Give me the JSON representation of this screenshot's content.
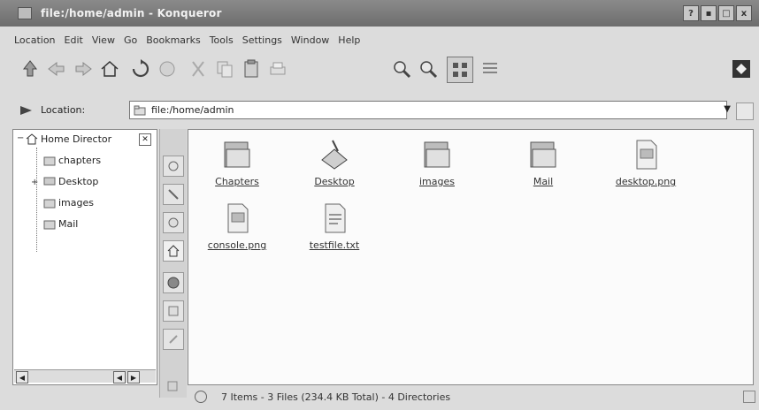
{
  "window": {
    "title": "file:/home/admin - Konqueror",
    "controls": [
      "?",
      "▪",
      "□",
      "x"
    ]
  },
  "menubar": {
    "items": [
      "Location",
      "Edit",
      "View",
      "Go",
      "Bookmarks",
      "Tools",
      "Settings",
      "Window",
      "Help"
    ]
  },
  "toolbar": {
    "icons": [
      "up-arrow-icon",
      "back-arrow-icon",
      "forward-arrow-icon",
      "home-icon",
      "reload-icon",
      "stop-icon",
      "cut-icon",
      "copy-icon",
      "paste-icon",
      "print-icon",
      "zoom-in-icon",
      "zoom-out-icon",
      "icon-view-icon",
      "detail-view-icon",
      "konqueror-logo-icon"
    ]
  },
  "location": {
    "label": "Location:",
    "value": "file:/home/admin"
  },
  "tree": {
    "root": "Home Director",
    "children": [
      "chapters",
      "Desktop",
      "images",
      "Mail"
    ]
  },
  "main": {
    "items": [
      {
        "label": "Chapters",
        "icon": "folder-icon"
      },
      {
        "label": "Desktop",
        "icon": "desktop-icon"
      },
      {
        "label": "images",
        "icon": "folder-icon"
      },
      {
        "label": "Mail",
        "icon": "folder-icon"
      },
      {
        "label": "desktop.png",
        "icon": "png-file-icon"
      },
      {
        "label": "console.png",
        "icon": "png-file-icon"
      },
      {
        "label": "testfile.txt",
        "icon": "text-file-icon"
      }
    ]
  },
  "status": {
    "text": "7 Items - 3 Files (234.4 KB Total) - 4 Directories"
  },
  "colors": {
    "titlebar": "#7a7a7a",
    "background": "#dcdcdc",
    "view_background": "#fbfbfb"
  }
}
